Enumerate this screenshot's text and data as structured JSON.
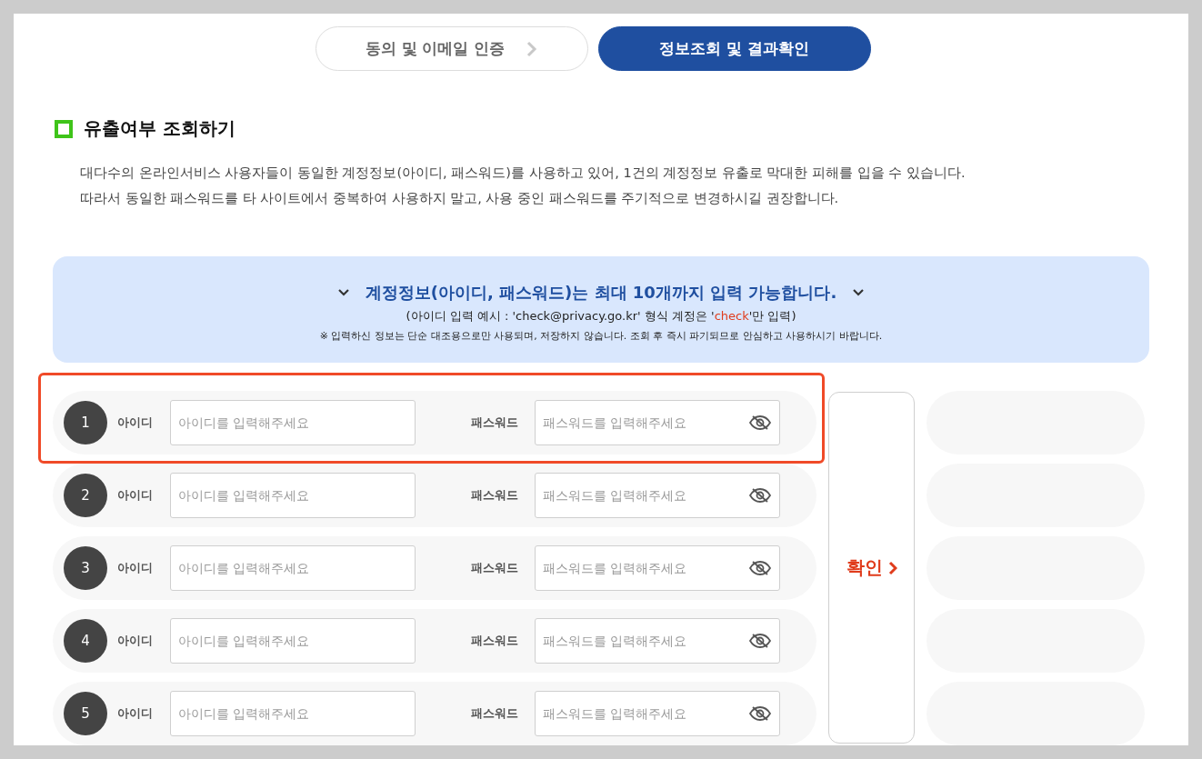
{
  "steps": [
    {
      "label": "동의 및 이메일 인증",
      "selected": false
    },
    {
      "label": "정보조회 및 결과확인",
      "selected": true
    }
  ],
  "section_title": "유출여부 조회하기",
  "description": [
    "대다수의 온라인서비스 사용자들이 동일한 계정정보(아이디, 패스워드)를 사용하고 있어, 1건의 계정정보 유출로 막대한 피해를 입을 수 있습니다.",
    "따라서 동일한 패스워드를 타 사이트에서 중복하여 사용하지 말고, 사용 중인 패스워드를 주기적으로 변경하시길 권장합니다."
  ],
  "notice": {
    "headline": "계정정보(아이디, 패스워드)는 최대 10개까지 입력 가능합니다.",
    "example": {
      "before": "(아이디 입력 예시 : 'check@privacy.go.kr' 형식 계정은 '",
      "highlight": "check",
      "after": "'만 입력)"
    },
    "note": "※ 입력하신 정보는 단순 대조용으로만 사용되며, 저장하지 않습니다. 조회 후 즉시 파기되므로 안심하고 사용하시기 바랍니다."
  },
  "accounts": [
    {
      "number": "1",
      "id_label": "아이디",
      "id_placeholder": "아이디를 입력해주세요",
      "pw_label": "패스워드",
      "pw_placeholder": "패스워드를 입력해주세요",
      "highlighted": true
    },
    {
      "number": "2",
      "id_label": "아이디",
      "id_placeholder": "아이디를 입력해주세요",
      "pw_label": "패스워드",
      "pw_placeholder": "패스워드를 입력해주세요",
      "highlighted": false
    },
    {
      "number": "3",
      "id_label": "아이디",
      "id_placeholder": "아이디를 입력해주세요",
      "pw_label": "패스워드",
      "pw_placeholder": "패스워드를 입력해주세요",
      "highlighted": false
    },
    {
      "number": "4",
      "id_label": "아이디",
      "id_placeholder": "아이디를 입력해주세요",
      "pw_label": "패스워드",
      "pw_placeholder": "패스워드를 입력해주세요",
      "highlighted": false
    },
    {
      "number": "5",
      "id_label": "아이디",
      "id_placeholder": "아이디를 입력해주세요",
      "pw_label": "패스워드",
      "pw_placeholder": "패스워드를 입력해주세요",
      "highlighted": false
    }
  ],
  "confirm_button": "확인"
}
